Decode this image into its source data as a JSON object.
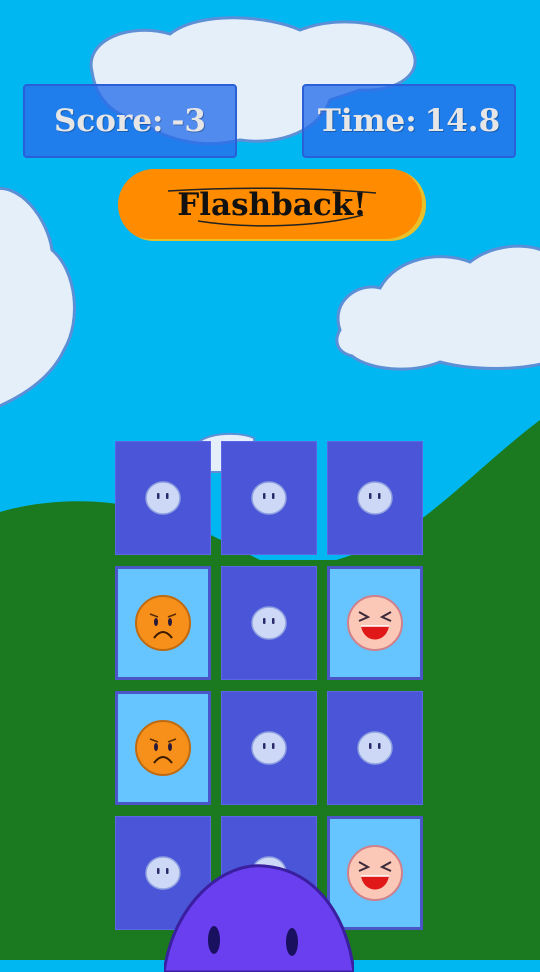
{
  "hud": {
    "score_label": "Score:",
    "score_value": "-3",
    "time_label": "Time:",
    "time_value": "14.8"
  },
  "flashback_button": {
    "label": "Flashback!"
  },
  "colors": {
    "sky": "#00b7f2",
    "hill": "#1b7a1f",
    "card_hidden": "#4b55d8",
    "card_revealed": "#66c4ff",
    "button": "#ff8c00"
  },
  "board": {
    "rows": 4,
    "columns": 3,
    "cards": [
      {
        "state": "hidden",
        "icon": "blob-icon"
      },
      {
        "state": "hidden",
        "icon": "blob-icon"
      },
      {
        "state": "hidden",
        "icon": "blob-icon"
      },
      {
        "state": "revealed",
        "icon": "sad-face-icon"
      },
      {
        "state": "hidden",
        "icon": "blob-icon"
      },
      {
        "state": "revealed",
        "icon": "laughing-face-icon"
      },
      {
        "state": "revealed",
        "icon": "sad-face-icon"
      },
      {
        "state": "hidden",
        "icon": "blob-icon"
      },
      {
        "state": "hidden",
        "icon": "blob-icon"
      },
      {
        "state": "hidden",
        "icon": "blob-icon"
      },
      {
        "state": "hidden",
        "icon": "blob-icon"
      },
      {
        "state": "revealed",
        "icon": "laughing-face-icon"
      }
    ]
  }
}
